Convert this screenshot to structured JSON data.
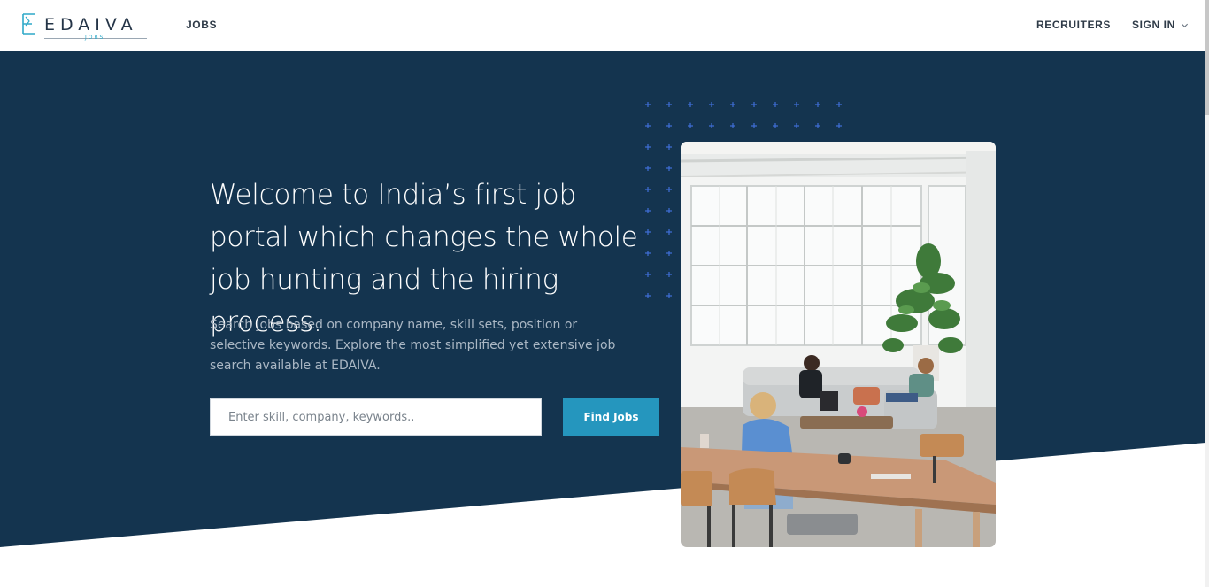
{
  "header": {
    "logo_text": "EDAIVA",
    "logo_subtext": "JOBS",
    "nav_jobs": "JOBS",
    "nav_recruiters": "RECRUITERS",
    "nav_signin": "SIGN IN"
  },
  "hero": {
    "headline": "Welcome to India’s first job portal which changes the whole job hunting and the hiring process.",
    "description": "Search jobs based on company name, skill sets, position or selective keywords. Explore the most simplified yet extensive job search available at EDAIVA.",
    "search_placeholder": "Enter skill, company, keywords..",
    "search_value": "",
    "find_button": "Find Jobs"
  },
  "colors": {
    "hero_bg": "#14344f",
    "accent": "#2596be",
    "dots": "#3f6fd8"
  },
  "icons": {
    "signin_chevron": "chevron-down-icon",
    "logo": "edaiva-logo-icon"
  }
}
